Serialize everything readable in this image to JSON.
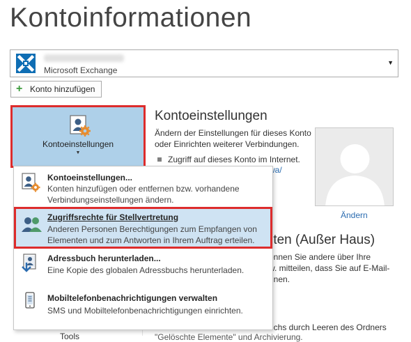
{
  "page_title": "Kontoinformationen",
  "account_selector": {
    "account_name": "",
    "account_type": "Microsoft Exchange",
    "icon": "exchange-icon",
    "dropdown_icon": "dropdown-arrow-icon"
  },
  "add_account_button": {
    "label": "Konto hinzufügen",
    "icon": "plus-icon"
  },
  "account_settings_button": {
    "label": "Kontoeinstellungen",
    "icon": "account-settings-icon"
  },
  "account_settings_section": {
    "title": "Kontoeinstellungen",
    "description": "Ändern der Einstellungen für dieses Konto oder Einrichten weiterer Verbindungen.",
    "bullet": "Zugriff auf dieses Konto im Internet.",
    "link_fragment": "wa/"
  },
  "profile_photo": {
    "change_link": "Ändern",
    "icon": "user-silhouette-icon"
  },
  "out_of_office_section": {
    "title_fragment": "rten (Außer Haus)",
    "desc_line1": "önnen Sie andere über Ihre",
    "desc_line2": "w. mitteilen, dass Sie auf E-Mail-",
    "desc_line3": "nnen."
  },
  "mailbox_cleanup": {
    "desc_fragment": "uchs durch Leeren des Ordners",
    "desc_fragment2": "\"Gelöschte Elemente\" und Archivierung.",
    "text_fragment": "Tools"
  },
  "dropdown_menu": {
    "items": [
      {
        "title": "Kontoeinstellungen...",
        "description": "Konten hinzufügen oder entfernen bzw. vorhandene Verbindungseinstellungen ändern.",
        "icon": "account-settings-icon"
      },
      {
        "title": "Zugriffsrechte für Stellvertretung",
        "description": "Anderen Personen Berechtigungen zum Empfangen von Elementen und zum Antworten in Ihrem Auftrag erteilen.",
        "icon": "delegate-access-icon"
      },
      {
        "title": "Adressbuch herunterladen...",
        "description": "Eine Kopie des globalen Adressbuchs herunterladen.",
        "icon": "download-address-book-icon"
      },
      {
        "title": "Mobiltelefonbenachrichtigungen verwalten",
        "description": "SMS und Mobiltelefonbenachrichtigungen einrichten.",
        "icon": "mobile-notifications-icon"
      }
    ]
  },
  "colors": {
    "highlight_red": "#dd2c2c",
    "button_blue": "#aed0e9",
    "selected_item_blue": "#cfe3f3",
    "link_blue": "#2b6cb0",
    "plus_green": "#3c9b3c"
  }
}
